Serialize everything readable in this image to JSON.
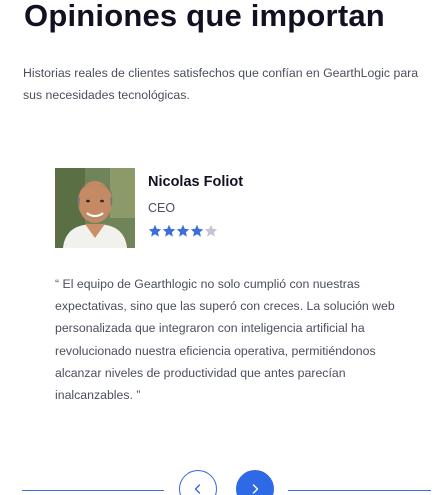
{
  "section": {
    "heading": "Opiniones que importan",
    "subheading": "Historias reales de clientes satisfechos que confían en GearthLogic para sus necesidades tecnológicas."
  },
  "testimonial": {
    "name": "Nicolas Foliot",
    "role": "CEO",
    "rating": 4,
    "rating_max": 5,
    "quote": "“ El equipo de Gearthlogic no solo cumplió con nuestras expectativas, sino que las superó con creces. La solución web personalizada que integraron con inteligencia artificial ha revolucionado nuestra eficiencia operativa, permitiéndonos alcanzar niveles de productividad que antes parecían inalcanzables. ”"
  },
  "navigation": {
    "prev_icon": "chevron-left-icon",
    "next_icon": "chevron-right-icon"
  },
  "colors": {
    "accent": "#2f6ae6",
    "star_filled": "#3b6fe0",
    "star_empty": "#c4c7cf",
    "text_body": "#4a4f5c",
    "text_heading": "#111122"
  }
}
